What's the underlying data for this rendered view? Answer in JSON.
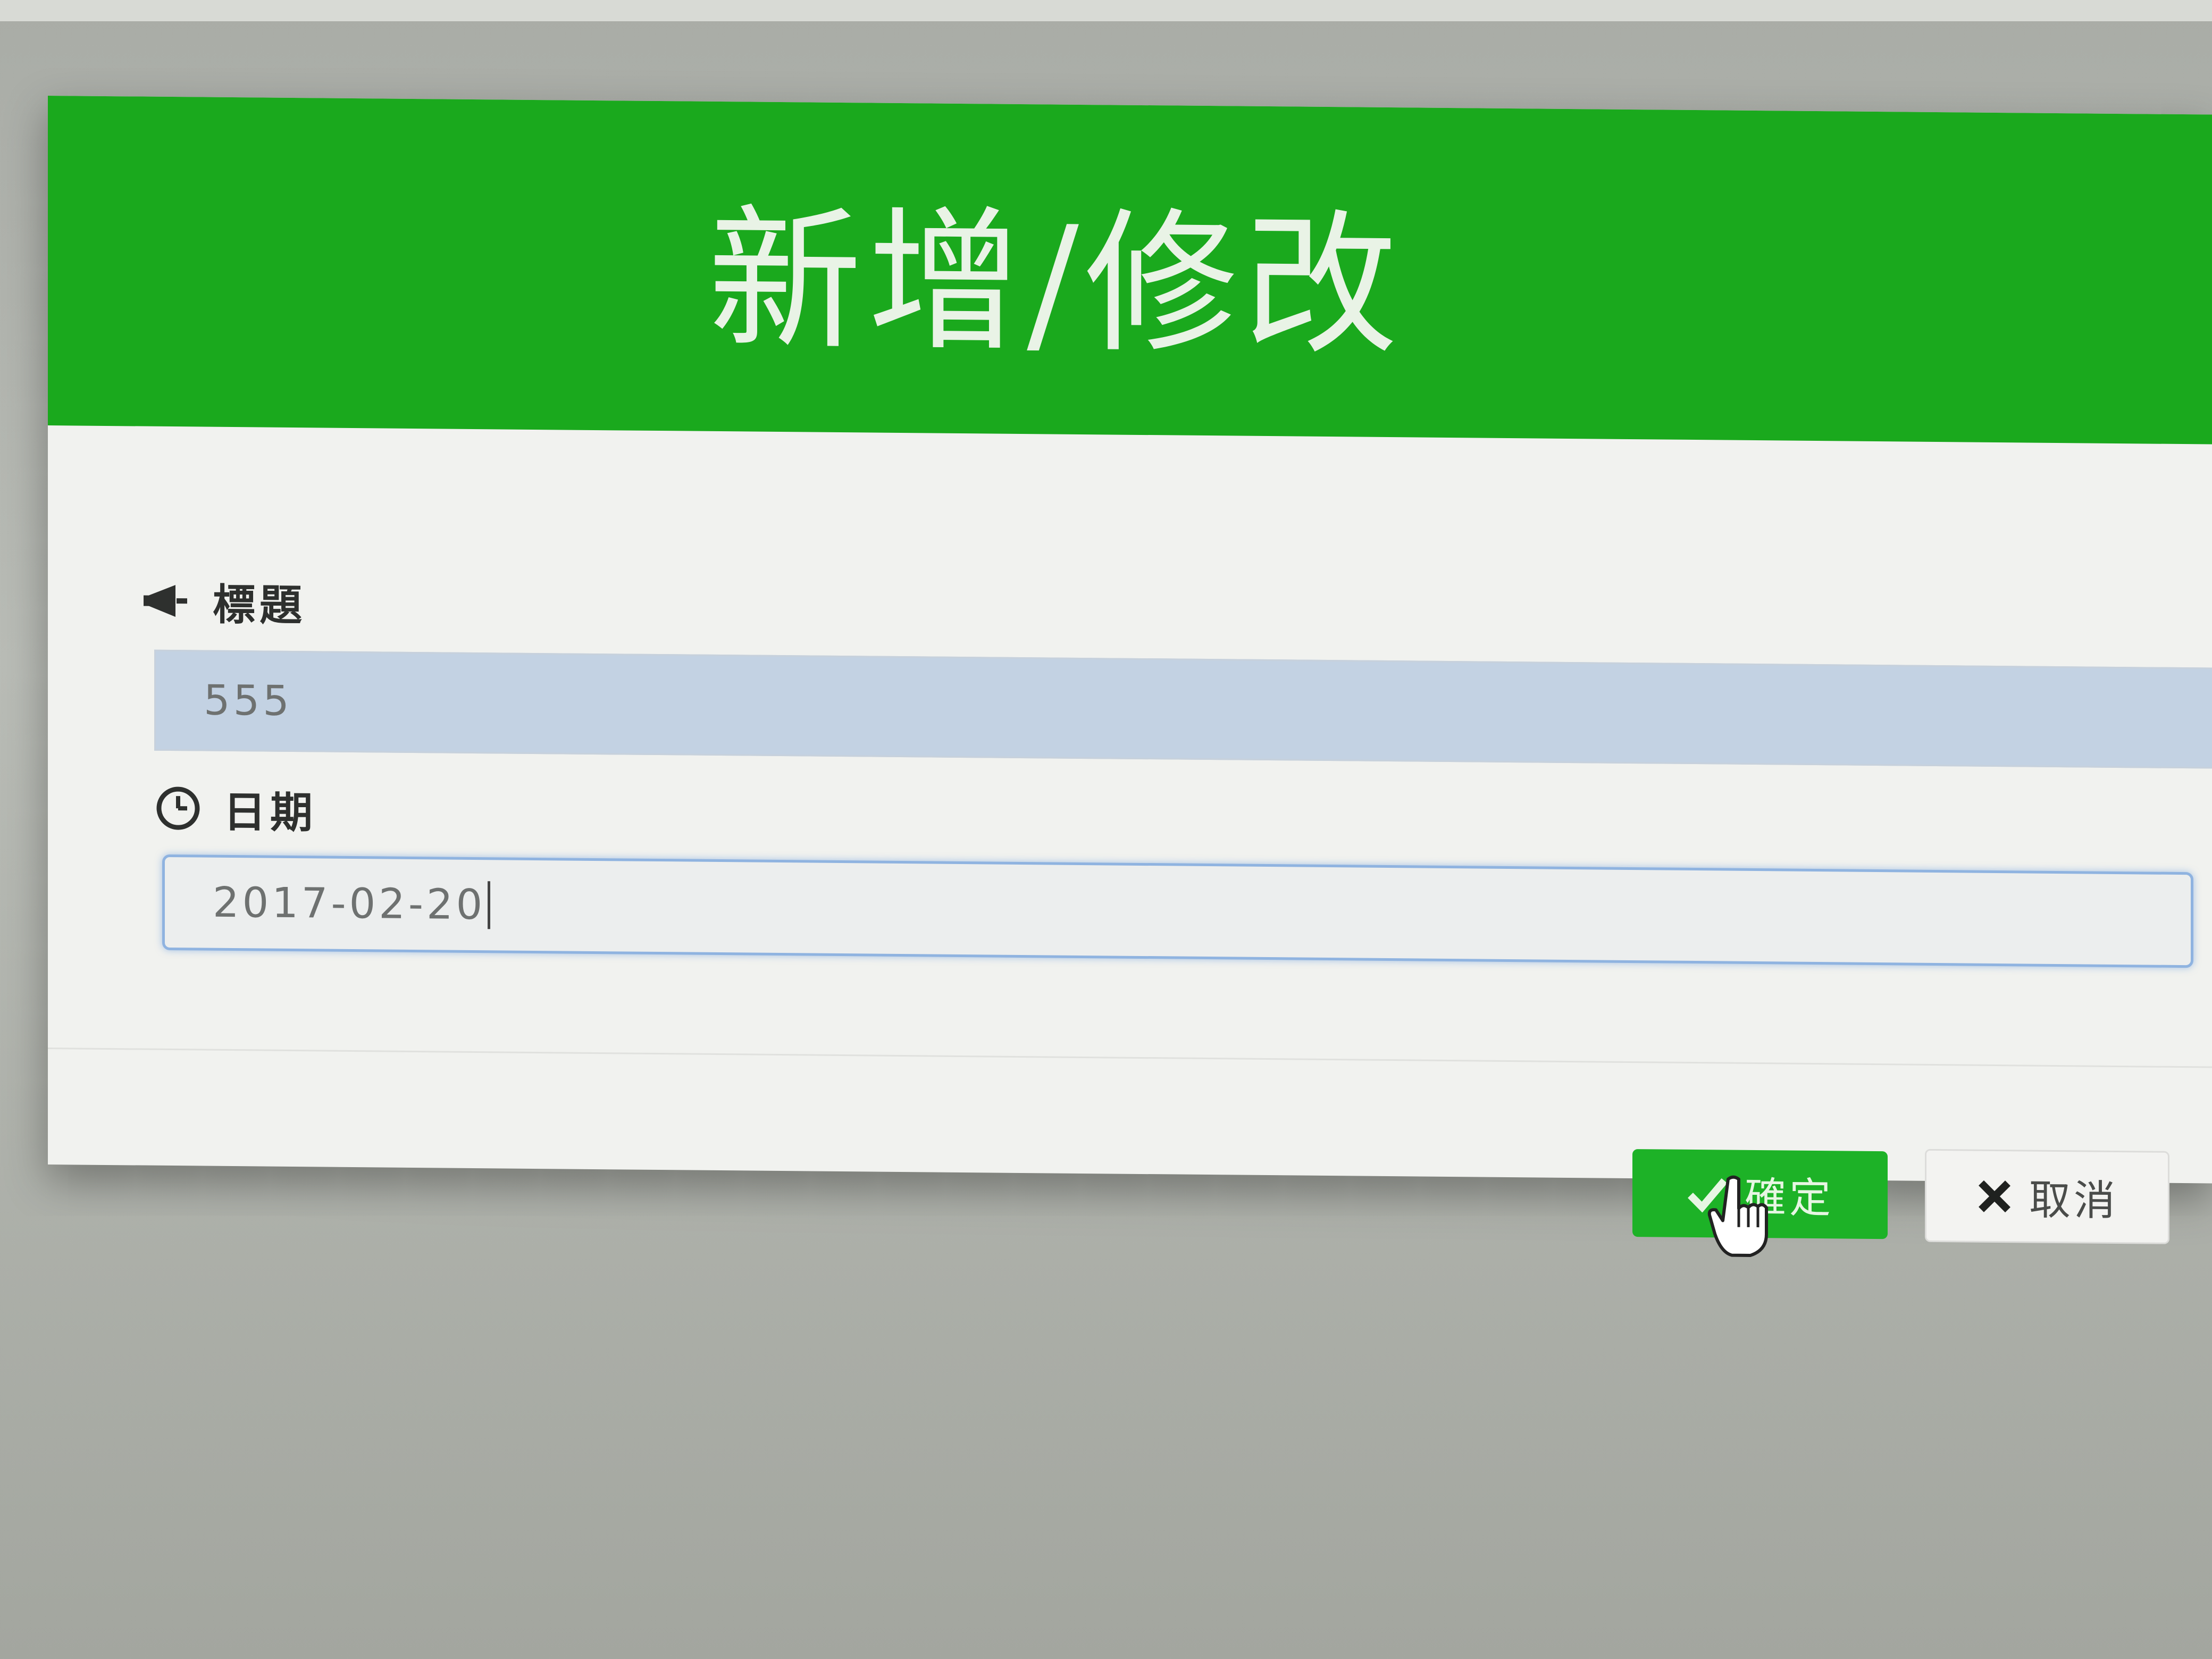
{
  "dialog": {
    "title": "新增/修改",
    "fields": {
      "title_label": "標題",
      "title_value": "555",
      "date_label": "日期",
      "date_value": "2017-02-20"
    },
    "buttons": {
      "confirm_label": "確定",
      "cancel_label": "取消"
    }
  },
  "icons": {
    "title_icon": "bullhorn-icon",
    "date_icon": "clock-icon",
    "confirm_icon": "check-icon",
    "cancel_icon": "close-icon",
    "cursor": "hand-pointer-cursor"
  },
  "colors": {
    "header_green": "#1aa91d",
    "confirm_green": "#1db227",
    "focus_border": "#8fb3e0",
    "autofill_bg": "#c3d2e3"
  }
}
